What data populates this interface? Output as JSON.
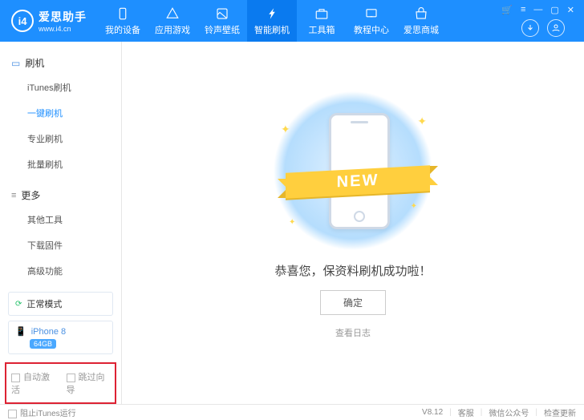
{
  "logo": {
    "badge": "i4",
    "title": "爱思助手",
    "url": "www.i4.cn"
  },
  "nav": [
    {
      "label": "我的设备",
      "icon": "device"
    },
    {
      "label": "应用游戏",
      "icon": "apps"
    },
    {
      "label": "铃声壁纸",
      "icon": "media"
    },
    {
      "label": "智能刷机",
      "icon": "flash",
      "active": true
    },
    {
      "label": "工具箱",
      "icon": "toolbox"
    },
    {
      "label": "教程中心",
      "icon": "tutorial"
    },
    {
      "label": "爱思商城",
      "icon": "store"
    }
  ],
  "sidebar": {
    "group1": {
      "title": "刷机",
      "items": [
        "iTunes刷机",
        "一键刷机",
        "专业刷机",
        "批量刷机"
      ],
      "activeIndex": 1
    },
    "group2": {
      "title": "更多",
      "items": [
        "其他工具",
        "下载固件",
        "高级功能"
      ]
    }
  },
  "mode": {
    "label": "正常模式"
  },
  "device": {
    "name": "iPhone 8",
    "storage": "64GB"
  },
  "options": {
    "opt1": "自动激活",
    "opt2": "跳过向导"
  },
  "main": {
    "ribbon": "NEW",
    "message": "恭喜您，保资料刷机成功啦！",
    "confirm": "确定",
    "log": "查看日志"
  },
  "footer": {
    "block": "阻止iTunes运行",
    "version": "V8.12",
    "support": "客服",
    "wechat": "微信公众号",
    "update": "检查更新"
  }
}
